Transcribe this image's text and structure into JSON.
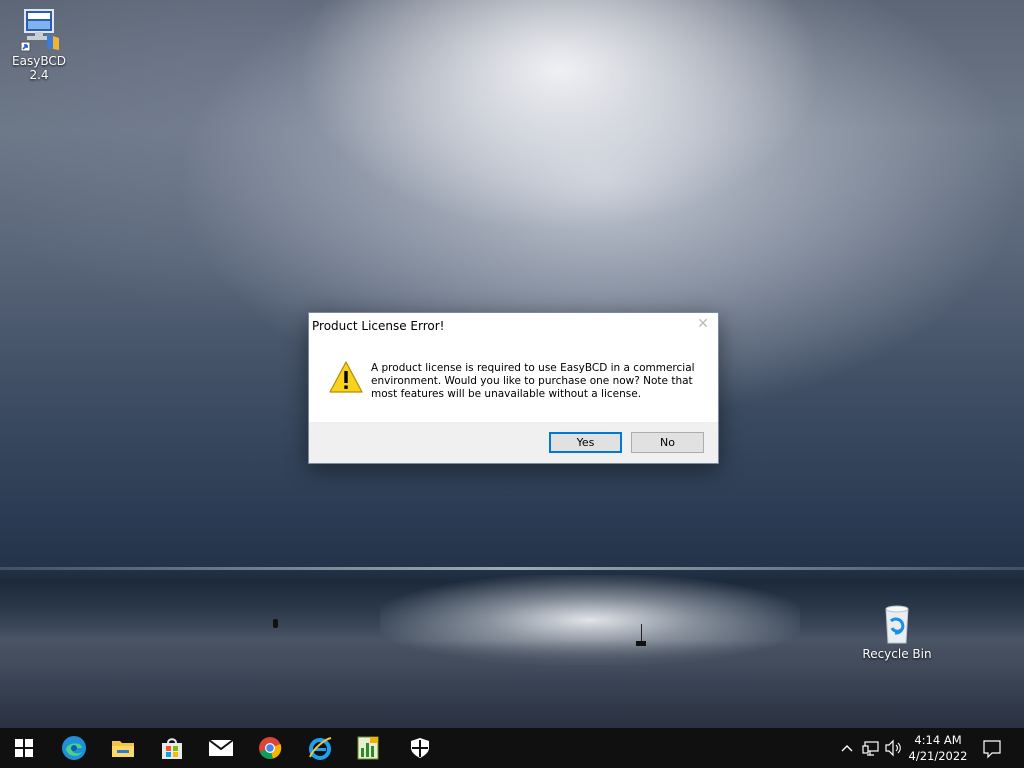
{
  "desktop": {
    "icons": [
      {
        "label": "EasyBCD 2.4",
        "icon": "easybcd-icon"
      },
      {
        "label": "Recycle Bin",
        "icon": "recycle-bin-icon"
      }
    ]
  },
  "dialog": {
    "title": "Product License Error!",
    "icon": "warning-icon",
    "message": "A product license is required to use EasyBCD in a commercial environment. Would you like to purchase one now? Note that most features will be unavailable without a license.",
    "buttons": {
      "yes": "Yes",
      "no": "No"
    },
    "close_glyph": "✕"
  },
  "taskbar": {
    "pinned": [
      "start-icon",
      "edge-icon",
      "file-explorer-icon",
      "store-icon",
      "mail-icon",
      "chrome-icon",
      "internet-explorer-icon",
      "easybcd-taskbar-icon",
      "security-icon"
    ],
    "clock": {
      "time": "4:14 AM",
      "date": "4/21/2022"
    }
  },
  "colors": {
    "accent": "#0078d7",
    "taskbar": "#101010"
  }
}
